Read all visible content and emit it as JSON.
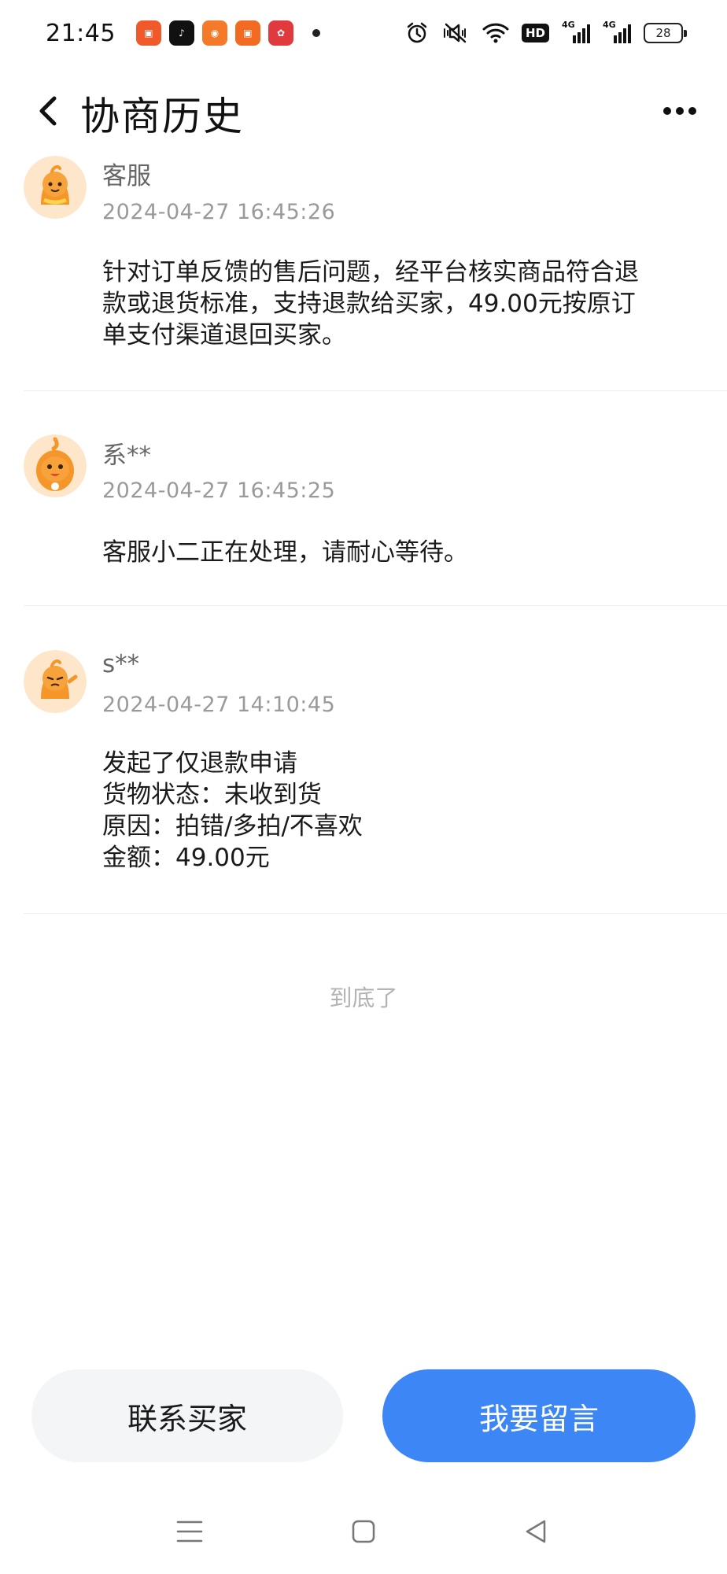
{
  "status_bar": {
    "time": "21:45",
    "battery": "28",
    "hd_label": "HD",
    "network_label": "4G",
    "icons": [
      "alarm-icon",
      "mute-vibrate-icon",
      "wifi-icon",
      "hd-voice-icon",
      "signal-4g-icon",
      "signal-4g-icon",
      "battery-icon"
    ],
    "app_icons": [
      "kuaishou-app-icon",
      "douyin-app-icon",
      "app-icon",
      "kuaishou-app-icon",
      "pinduoduo-app-icon"
    ]
  },
  "header": {
    "title": "协商历史",
    "back_icon": "chevron-left-icon",
    "more_icon": "more-dots-icon"
  },
  "entries": [
    {
      "name": "客服",
      "time": "2024-04-27 16:45:26",
      "lines": [
        "针对订单反馈的售后问题，经平台核实商品符合退",
        "款或退货标准，支持退款给买家，49.00元按原订",
        "单支付渠道退回买家。"
      ]
    },
    {
      "name": "系**",
      "time": "2024-04-27 16:45:25",
      "lines": [
        "客服小二正在处理，请耐心等待。"
      ]
    },
    {
      "name": "s**",
      "time": "2024-04-27 14:10:45",
      "lines": [
        "发起了仅退款申请",
        "货物状态：未收到货",
        "原因：拍错/多拍/不喜欢",
        "金额：49.00元"
      ]
    }
  ],
  "end_text": "到底了",
  "buttons": {
    "contact": "联系买家",
    "message": "我要留言"
  },
  "nav_bar": {
    "icons": [
      "menu-icon",
      "home-square-icon",
      "back-triangle-icon"
    ]
  },
  "colors": {
    "accent": "#3d86f5",
    "secondary_button_bg": "#f4f5f7",
    "avatar_orange": "#f5962a"
  }
}
